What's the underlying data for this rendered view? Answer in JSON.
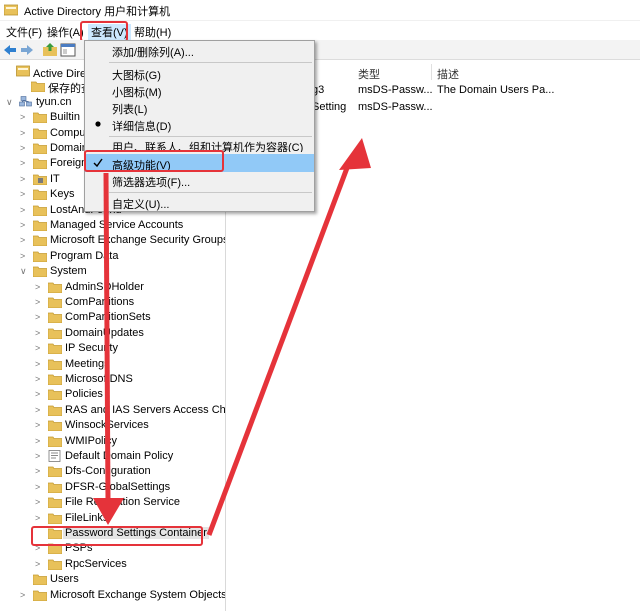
{
  "window": {
    "title": "Active Directory 用户和计算机"
  },
  "menubar": [
    {
      "label": "文件(F)"
    },
    {
      "label": "操作(A)"
    },
    {
      "label": "查看(V)"
    },
    {
      "label": "帮助(H)"
    }
  ],
  "tree": {
    "rows": [
      {
        "label": "Active Directory 用户和计算机"
      },
      {
        "label": "保存的查询"
      },
      {
        "label": "tyun.cn"
      },
      {
        "label": "Builtin"
      },
      {
        "label": "Computers"
      },
      {
        "label": "Domain Controllers"
      },
      {
        "label": "ForeignSecurityPrincipals"
      },
      {
        "label": "IT"
      },
      {
        "label": "Keys"
      },
      {
        "label": "LostAndFound"
      },
      {
        "label": "Managed Service Accounts"
      },
      {
        "label": "Microsoft Exchange Security Groups"
      },
      {
        "label": "Program Data"
      },
      {
        "label": "System"
      },
      {
        "label": "AdminSDHolder"
      },
      {
        "label": "ComPartitions"
      },
      {
        "label": "ComPartitionSets"
      },
      {
        "label": "DomainUpdates"
      },
      {
        "label": "IP Security"
      },
      {
        "label": "Meetings"
      },
      {
        "label": "MicrosoftDNS"
      },
      {
        "label": "Policies"
      },
      {
        "label": "RAS and IAS Servers Access Check"
      },
      {
        "label": "WinsockServices"
      },
      {
        "label": "WMIPolicy"
      },
      {
        "label": "Default Domain Policy"
      },
      {
        "label": "Dfs-Configuration"
      },
      {
        "label": "DFSR-GlobalSettings"
      },
      {
        "label": "File Replication Service"
      },
      {
        "label": "FileLinks"
      },
      {
        "label": "Password Settings Container"
      },
      {
        "label": "PSPs"
      },
      {
        "label": "RpcServices"
      },
      {
        "label": "Users"
      },
      {
        "label": "Microsoft Exchange System Objects"
      }
    ]
  },
  "list": {
    "columns": [
      {
        "label": "类型"
      },
      {
        "label": "描述"
      }
    ],
    "rows": [
      {
        "name": "g3",
        "type": "msDS-Passw...",
        "desc": "The Domain Users Pa..."
      },
      {
        "name": "Setting",
        "type": "msDS-Passw...",
        "desc": ""
      }
    ]
  },
  "view_menu": {
    "items": [
      {
        "label": "添加/删除列(A)..."
      },
      {
        "label": "大图标(G)"
      },
      {
        "label": "小图标(M)"
      },
      {
        "label": "列表(L)"
      },
      {
        "label": "详细信息(D)"
      },
      {
        "label": "用户、联系人、组和计算机作为容器(C)"
      },
      {
        "label": "高级功能(V)"
      },
      {
        "label": "筛选器选项(F)..."
      },
      {
        "label": "自定义(U)..."
      }
    ]
  },
  "colors": {
    "annotation": "#e5333a",
    "menu_highlight": "#91c9f7",
    "folder": "#e8c15a"
  }
}
